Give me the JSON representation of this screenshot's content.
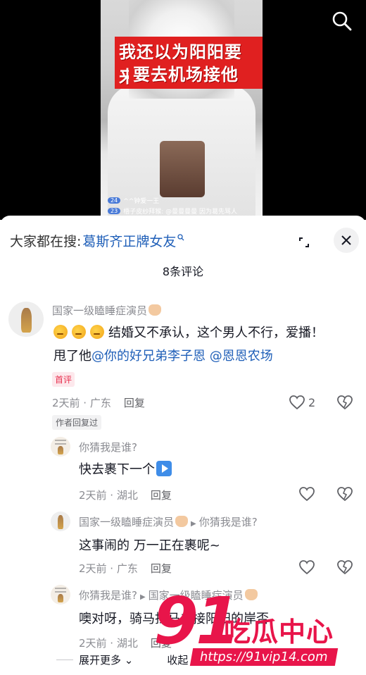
{
  "video": {
    "caption_line1": "我还以为阳阳要来",
    "caption_line2": "要去机场接他",
    "live_row1_badge": "24",
    "live_row1_text": "^^钟爱一王",
    "live_row2_badge": "23",
    "live_row2_text": "梧子皮纱拜猴: @曼曼曼曼 因为葛先骂人"
  },
  "sheet": {
    "hot_search_prefix": "大家都在搜:",
    "hot_search_keyword": "葛斯齐正牌女友",
    "hot_search_icon": "search-icon",
    "comment_count": "8条评论",
    "expand_more": "展开更多",
    "collapse": "收起"
  },
  "comments": {
    "c1": {
      "username": "国家一级瞌睡症演员",
      "text_main": "结婚又不承认，这个男人不行，爱播！甩了他",
      "mention1": "@你的好兄弟李子恩",
      "mention2": "@恩恩农场",
      "badge": "首评",
      "time": "2天前 · 广东",
      "reply": "回复",
      "likes": "2",
      "author_tag": "作者回复过"
    },
    "r1": {
      "username": "你猜我是谁?",
      "text": "快去裹下一个",
      "time": "2天前 · 湖北",
      "reply": "回复"
    },
    "r2": {
      "username": "国家一级瞌睡症演员",
      "reply_to": "你猜我是谁?",
      "text": "这事闹的 万一正在裹呢~",
      "time": "2天前 · 广东",
      "reply": "回复"
    },
    "r3": {
      "username": "你猜我是谁?",
      "reply_to": "国家一级瞌睡症演员",
      "text": "噢对呀，骑马找马去接阳阳的岸否",
      "time": "2天前 · 湖北",
      "reply": "回复"
    }
  },
  "watermark": {
    "num": "91",
    "cn": "吃瓜中心",
    "url": "https://91vip14.com"
  }
}
